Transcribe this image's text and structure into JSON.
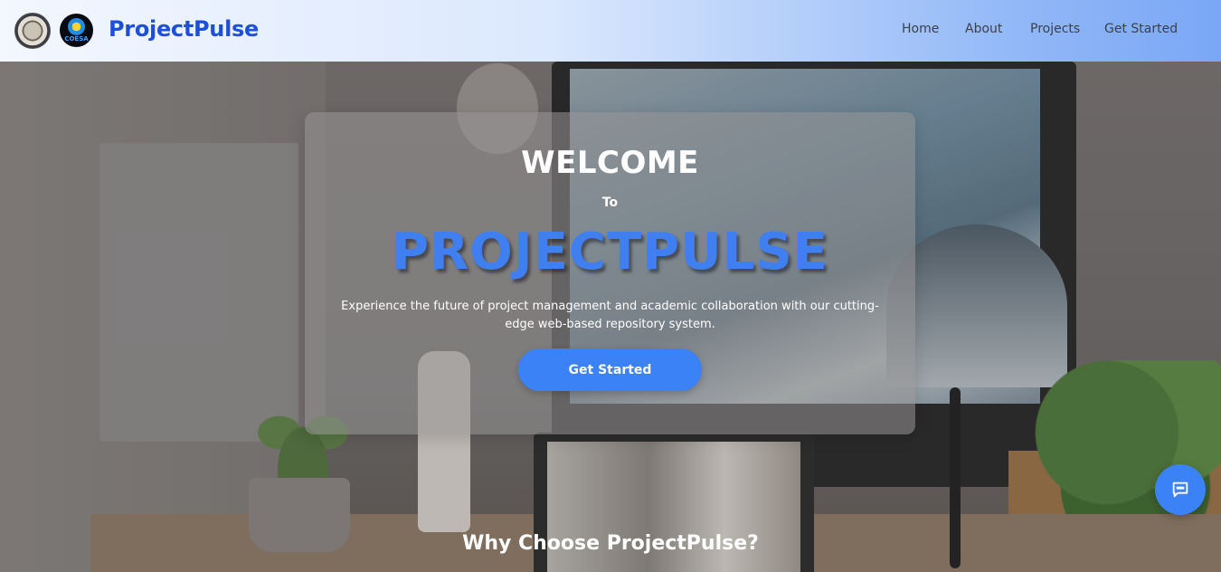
{
  "header": {
    "brand": "ProjectPulse",
    "logos": [
      "university-seal-icon",
      "coesa-logo-icon"
    ],
    "logo2_text": "COESA",
    "nav": [
      {
        "label": "Home"
      },
      {
        "label": "About"
      },
      {
        "label": "Projects"
      },
      {
        "label": "Get Started"
      }
    ],
    "brand_color": "#1e4fd8"
  },
  "hero": {
    "welcome": "WELCOME",
    "to": "To",
    "name": "PROJECTPULSE",
    "tagline": "Experience the future of project management and academic collaboration with our cutting-edge web-based repository system.",
    "cta_label": "Get Started",
    "accent_color": "#3b82f6"
  },
  "features": {
    "title": "Why Choose ProjectPulse?"
  },
  "chat": {
    "icon": "chat-bubble-icon"
  }
}
